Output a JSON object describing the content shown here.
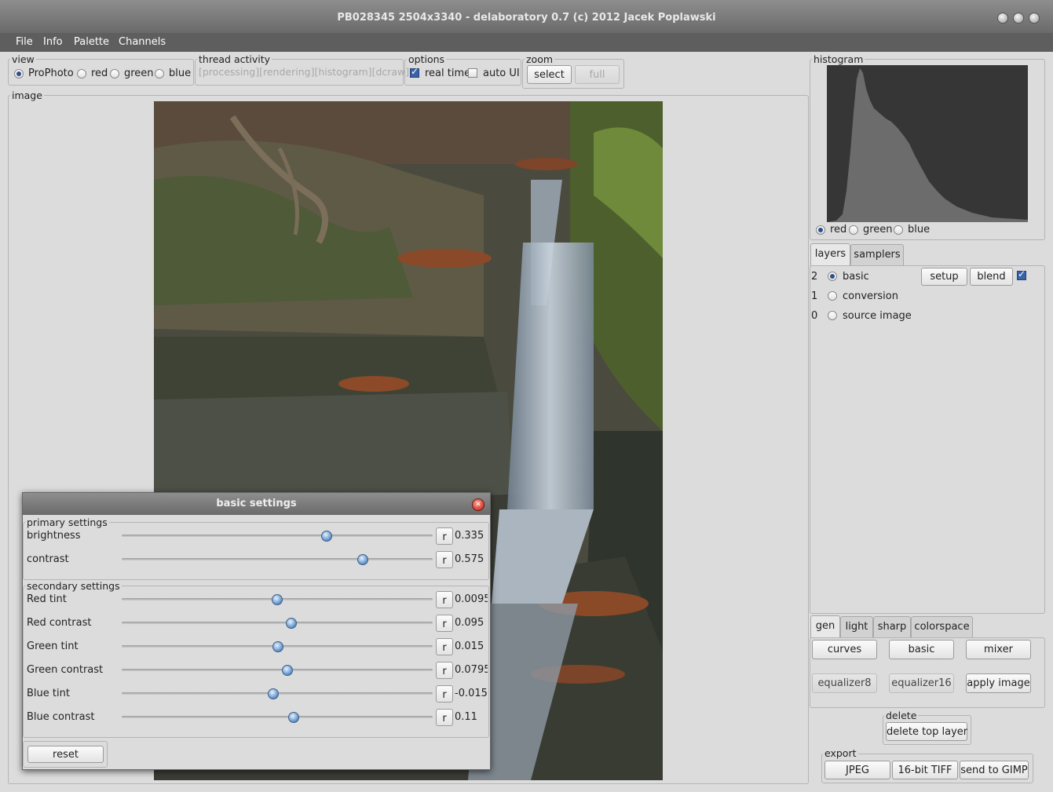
{
  "window": {
    "title": "PB028345 2504x3340 - delaboratory 0.7 (c) 2012 Jacek Poplawski"
  },
  "menu": [
    "File",
    "Info",
    "Palette",
    "Channels"
  ],
  "view": {
    "label": "view",
    "options": [
      "ProPhoto",
      "red",
      "green",
      "blue"
    ],
    "selected": "ProPhoto"
  },
  "thread_activity": {
    "label": "thread activity",
    "text": "[processing][rendering][histogram][dcraw]"
  },
  "options": {
    "label": "options",
    "real_time": "real time",
    "real_time_checked": true,
    "auto_ui": "auto UI",
    "auto_ui_checked": false
  },
  "zoom": {
    "label": "zoom",
    "select": "select",
    "full": "full"
  },
  "image": {
    "label": "image"
  },
  "histogram": {
    "label": "histogram",
    "channels": [
      "red",
      "green",
      "blue"
    ],
    "selected": "red",
    "bg_color": "#363636",
    "fill_color": "#6c6c6c"
  },
  "layers_tabs": [
    "layers",
    "samplers"
  ],
  "layers": [
    {
      "index": "2",
      "name": "basic",
      "selected": true
    },
    {
      "index": "1",
      "name": "conversion",
      "selected": false
    },
    {
      "index": "0",
      "name": "source image",
      "selected": false
    }
  ],
  "layer_actions": {
    "setup": "setup",
    "blend": "blend",
    "enabled": true
  },
  "tools_tabs": [
    "gen",
    "light",
    "sharp",
    "colorspace"
  ],
  "tools": [
    "curves",
    "basic",
    "mixer",
    "equalizer8",
    "equalizer16",
    "apply image"
  ],
  "delete": {
    "label": "delete",
    "button": "delete top layer"
  },
  "export": {
    "label": "export",
    "buttons": [
      "JPEG",
      "16-bit TIFF",
      "send to GIMP"
    ]
  },
  "basic_settings": {
    "title": "basic settings",
    "primary_label": "primary settings",
    "secondary_label": "secondary settings",
    "reset_symbol": "r",
    "primary": [
      {
        "name": "brightness",
        "value": "0.335",
        "position": 0.66
      },
      {
        "name": "contrast",
        "value": "0.575",
        "position": 0.775
      }
    ],
    "secondary": [
      {
        "name": "Red tint",
        "value": "0.0095",
        "position": 0.5
      },
      {
        "name": "Red contrast",
        "value": "0.095",
        "position": 0.545
      },
      {
        "name": "Green tint",
        "value": "0.015",
        "position": 0.502
      },
      {
        "name": "Green contrast",
        "value": "0.0795",
        "position": 0.533
      },
      {
        "name": "Blue tint",
        "value": "-0.015",
        "position": 0.487
      },
      {
        "name": "Blue contrast",
        "value": "0.11",
        "position": 0.552
      }
    ],
    "reset": "reset"
  }
}
